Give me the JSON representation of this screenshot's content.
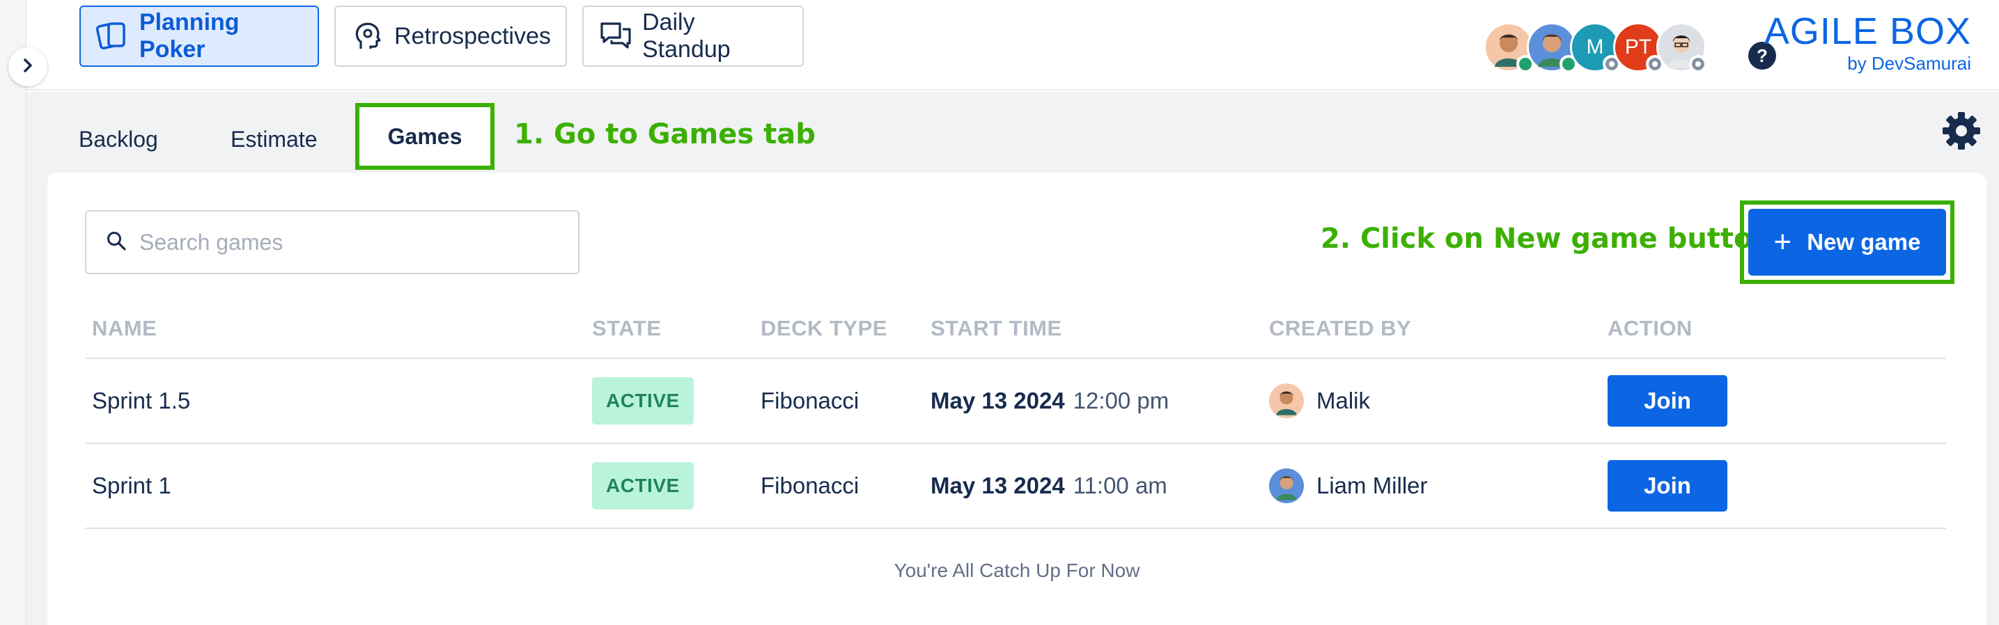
{
  "apps": [
    {
      "label": "Planning Poker",
      "icon": "cards-icon",
      "active": true
    },
    {
      "label": "Retrospectives",
      "icon": "head-icon",
      "active": false
    },
    {
      "label": "Daily Standup",
      "icon": "chat-icon",
      "active": false
    }
  ],
  "participants": [
    {
      "name": "participant-1",
      "initials": "",
      "color": "#f5c7a8",
      "status": "online"
    },
    {
      "name": "participant-2",
      "initials": "",
      "color": "#5b8fd9",
      "status": "online"
    },
    {
      "name": "participant-3",
      "initials": "M",
      "color": "#1d9bb5",
      "status": "offline"
    },
    {
      "name": "participant-4",
      "initials": "PT",
      "color": "#e03c1a",
      "status": "offline"
    },
    {
      "name": "participant-5",
      "initials": "",
      "color": "#dcdfe4",
      "status": "offline"
    }
  ],
  "help_label": "?",
  "brand": {
    "title": "AGILE BOX",
    "subtitle": "by DevSamurai"
  },
  "tabs": {
    "backlog": "Backlog",
    "estimate": "Estimate",
    "games": "Games"
  },
  "annotations": {
    "step1": "1. Go to Games tab",
    "step2": "2. Click on New game button"
  },
  "search": {
    "placeholder": "Search games"
  },
  "new_game_label": "New game",
  "table": {
    "columns": [
      "NAME",
      "STATE",
      "DECK TYPE",
      "START TIME",
      "CREATED BY",
      "ACTION"
    ],
    "rows": [
      {
        "name": "Sprint 1.5",
        "state": "ACTIVE",
        "deck": "Fibonacci",
        "date": "May 13 2024",
        "time": "12:00 pm",
        "creator": "Malik",
        "action": "Join"
      },
      {
        "name": "Sprint 1",
        "state": "ACTIVE",
        "deck": "Fibonacci",
        "date": "May 13 2024",
        "time": "11:00 am",
        "creator": "Liam Miller",
        "action": "Join"
      }
    ]
  },
  "footer": "You're All Catch Up For Now",
  "colors": {
    "accent": "#0c66e4",
    "annotation": "#3cb000",
    "active_badge_bg": "#baf3db",
    "active_badge_text": "#1f845a"
  }
}
